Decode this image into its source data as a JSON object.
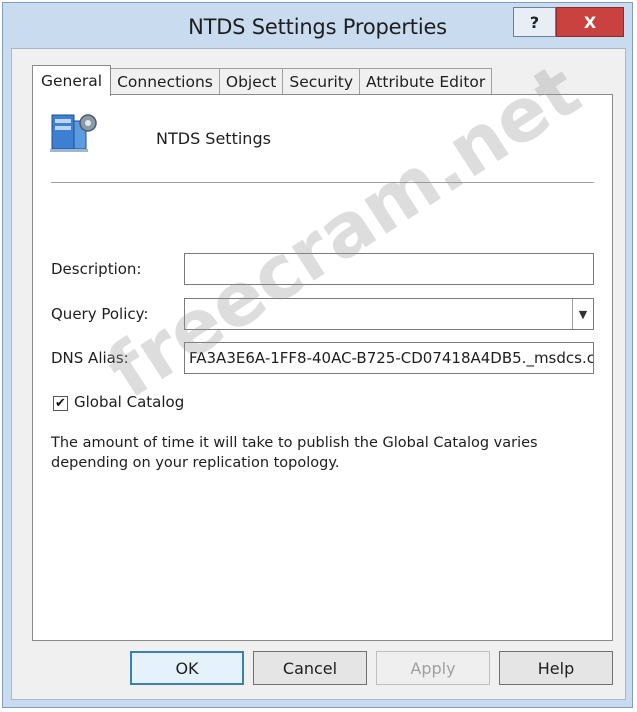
{
  "window": {
    "title": "NTDS Settings Properties",
    "help_glyph": "?",
    "close_glyph": "X"
  },
  "tabs": [
    {
      "label": "General",
      "active": true
    },
    {
      "label": "Connections",
      "active": false
    },
    {
      "label": "Object",
      "active": false
    },
    {
      "label": "Security",
      "active": false
    },
    {
      "label": "Attribute Editor",
      "active": false
    }
  ],
  "general": {
    "header_title": "NTDS Settings",
    "description": {
      "label": "Description:",
      "value": ""
    },
    "query_policy": {
      "label": "Query Policy:",
      "value": ""
    },
    "dns_alias": {
      "label": "DNS Alias:",
      "value": "FA3A3E6A-1FF8-40AC-B725-CD07418A4DB5._msdcs.c"
    },
    "global_catalog": {
      "label": "Global Catalog",
      "checked": true
    },
    "info_text": "The amount of time it will take to publish the Global Catalog varies depending on your replication topology."
  },
  "buttons": {
    "ok": "OK",
    "cancel": "Cancel",
    "apply": "Apply",
    "help": "Help"
  },
  "watermark": "freecram.net",
  "colors": {
    "titlebar": "#c9dcef",
    "close_button": "#c9423f",
    "dialog_bg": "#f0f0f0",
    "default_button_border": "#3c7fb1"
  }
}
